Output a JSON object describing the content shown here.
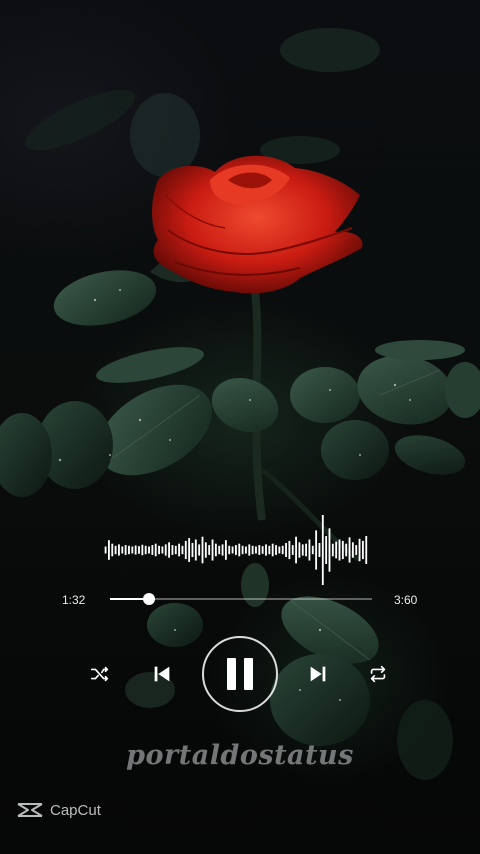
{
  "player": {
    "current_time": "1:32",
    "total_time": "3:60",
    "progress": 0.15,
    "state": "playing"
  },
  "icons": {
    "shuffle": "shuffle-icon",
    "previous": "skip-previous-icon",
    "pause": "pause-icon",
    "next": "skip-next-icon",
    "repeat": "repeat-icon",
    "capcut": "capcut-logo-icon"
  },
  "overlay": {
    "watermark": "portaldostatus",
    "brand": "CapCut"
  },
  "colors": {
    "rose": "#d3261a",
    "control": "#ffffff",
    "track": "#9a9a9a"
  },
  "waveform": {
    "levels": [
      0.1,
      0.28,
      0.18,
      0.12,
      0.16,
      0.1,
      0.14,
      0.12,
      0.1,
      0.13,
      0.11,
      0.15,
      0.12,
      0.1,
      0.14,
      0.18,
      0.12,
      0.1,
      0.16,
      0.22,
      0.14,
      0.12,
      0.18,
      0.12,
      0.26,
      0.34,
      0.2,
      0.3,
      0.16,
      0.38,
      0.22,
      0.14,
      0.3,
      0.18,
      0.12,
      0.16,
      0.28,
      0.12,
      0.1,
      0.14,
      0.18,
      0.12,
      0.1,
      0.16,
      0.12,
      0.1,
      0.14,
      0.11,
      0.16,
      0.12,
      0.18,
      0.14,
      0.1,
      0.12,
      0.2,
      0.26,
      0.14,
      0.38,
      0.22,
      0.16,
      0.18,
      0.3,
      0.12,
      0.56,
      0.2,
      1.0,
      0.4,
      0.62,
      0.18,
      0.24,
      0.3,
      0.26,
      0.18,
      0.36,
      0.22,
      0.14,
      0.32,
      0.26,
      0.4
    ]
  }
}
